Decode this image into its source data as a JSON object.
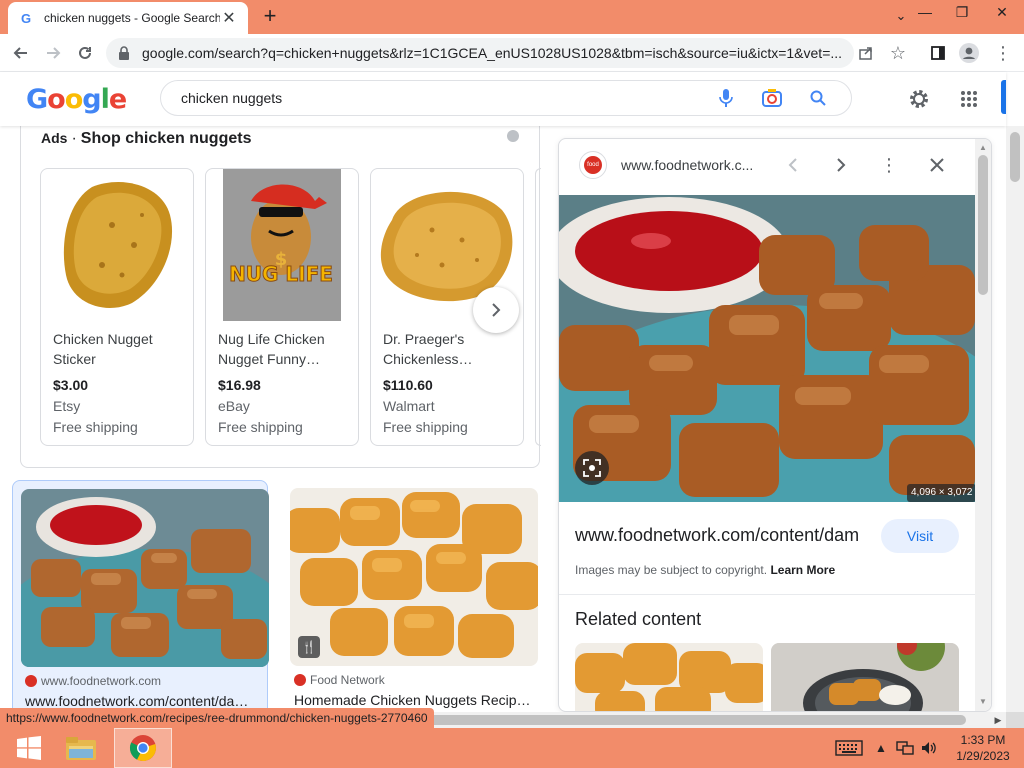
{
  "browser": {
    "tab_title": "chicken nuggets - Google Search",
    "tab_favicon": "G",
    "new_tab_label": "+",
    "url_host": "google.com",
    "url_path": "/search?q=chicken+nuggets&rlz=1C1GCEA_enUS1028US1028&tbm=isch&source=iu&ictx=1&vet=...",
    "status_url": "https://www.foodnetwork.com/recipes/ree-drummond/chicken-nuggets-2770460"
  },
  "search": {
    "query": "chicken nuggets",
    "logo_letters": [
      "G",
      "o",
      "o",
      "g",
      "l",
      "e"
    ]
  },
  "ads": {
    "label": "Ads",
    "separator": "·",
    "title": "Shop chicken nuggets",
    "products": [
      {
        "name": "Chicken Nugget Sticker",
        "price": "$3.00",
        "store": "Etsy",
        "shipping": "Free shipping"
      },
      {
        "name": "Nug Life Chicken Nugget Funny…",
        "price": "$16.98",
        "store": "eBay",
        "shipping": "Free shipping",
        "image_text": "NUG LIFE",
        "image_symbol": "$"
      },
      {
        "name": "Dr. Praeger's Chickenless…",
        "price": "$110.60",
        "store": "Walmart",
        "shipping": "Free shipping"
      }
    ]
  },
  "results": [
    {
      "source": "www.foodnetwork.com",
      "title": "www.foodnetwork.com/content/da…"
    },
    {
      "source": "Food Network",
      "title": "Homemade Chicken Nuggets Recip…"
    }
  ],
  "panel": {
    "site": "www.foodnetwork.c...",
    "favicon_text": "food",
    "dimensions": "4,096 × 3,072",
    "url": "www.foodnetwork.com/content/dam",
    "visit_label": "Visit",
    "copyright": "Images may be subject to copyright.",
    "learn_more": "Learn More",
    "related_title": "Related content"
  },
  "taskbar": {
    "time": "1:33 PM",
    "date": "1/29/2023"
  },
  "colors": {
    "chrome_accent": "#f28c6a",
    "google_blue": "#1a73e8",
    "visit_bg": "#e8f0fe"
  }
}
